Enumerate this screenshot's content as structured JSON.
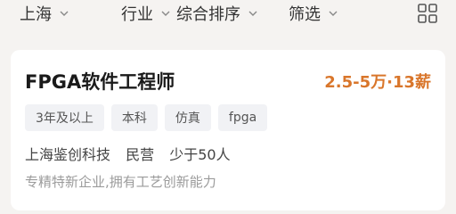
{
  "filters": {
    "city": "上海",
    "industry": "行业",
    "sort": "综合排序",
    "filter": "筛选"
  },
  "layout_toggle": {
    "icon": "grid-icon"
  },
  "job": {
    "title": "FPGA软件工程师",
    "salary": "2.5-5万·13薪",
    "tags": [
      "3年及以上",
      "本科",
      "仿真",
      "fpga"
    ],
    "company": {
      "name": "上海鉴创科技",
      "type": "民营",
      "size": "少于50人"
    },
    "description": "专精特新企业,拥有工艺创新能力"
  },
  "colors": {
    "background": "#f5f3f1",
    "salary": "#d9762b",
    "tag_bg": "#f1f2f5"
  }
}
